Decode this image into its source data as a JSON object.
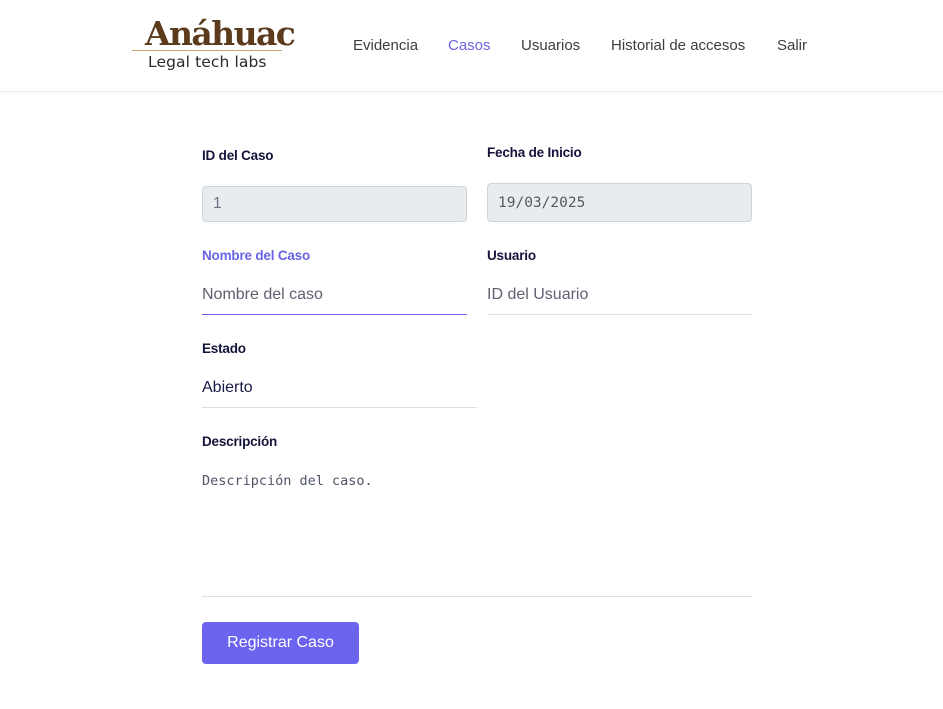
{
  "brand": {
    "logo_main": "Anáhuac",
    "logo_sub": "Legal tech labs"
  },
  "nav": {
    "items": [
      {
        "label": "Evidencia",
        "active": false
      },
      {
        "label": "Casos",
        "active": true
      },
      {
        "label": "Usuarios",
        "active": false
      },
      {
        "label": "Historial de accesos",
        "active": false
      },
      {
        "label": "Salir",
        "active": false
      }
    ]
  },
  "form": {
    "case_id": {
      "label": "ID del Caso",
      "value": "1"
    },
    "start_date": {
      "label": "Fecha de Inicio",
      "value": "19/03/2025"
    },
    "case_name": {
      "label": "Nombre del Caso",
      "placeholder": "Nombre del caso",
      "value": ""
    },
    "user": {
      "label": "Usuario",
      "placeholder": "ID del Usuario",
      "value": ""
    },
    "status": {
      "label": "Estado",
      "value": "Abierto"
    },
    "description": {
      "label": "Descripción",
      "placeholder": "Descripción del caso.",
      "value": ""
    },
    "submit_label": "Registrar Caso"
  },
  "colors": {
    "accent": "#6c63ef",
    "label": "#14133a",
    "logo": "#5b3b1c"
  }
}
